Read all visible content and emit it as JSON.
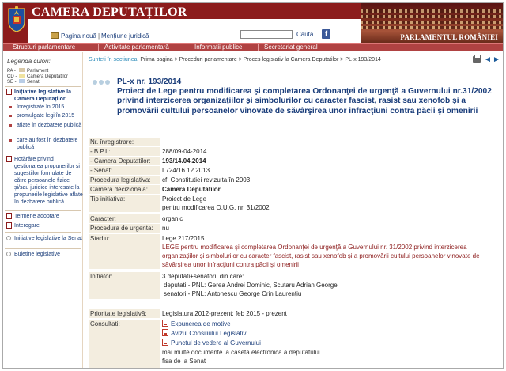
{
  "header": {
    "site_title": "CAMERA DEPUTAȚILOR",
    "top_links": [
      "Pagina nouă",
      "Mențiune juridică"
    ],
    "search_placeholder": "",
    "search_label": "Caută",
    "facebook_glyph": "f",
    "parliament_label": "PARLAMENTUL ROMÂNIEI"
  },
  "nav": {
    "items": [
      "Structuri parlamentare",
      "Activitate parlamentară",
      "Informații publice",
      "Secretariat general"
    ]
  },
  "sidebar": {
    "legend_title": "Legendă culori:",
    "legend": [
      {
        "code": "PA -",
        "label": "Parlament",
        "color": "#d9c9a8"
      },
      {
        "code": "CD -",
        "label": "Camera Deputatilor",
        "color": "#f0e3a0"
      },
      {
        "code": "SE -",
        "label": "Senat",
        "color": "#b9cde6"
      }
    ],
    "items": [
      {
        "label": "Inițiative legislative la Camera Deputaților"
      },
      {
        "label": "înregistrate în 2015"
      },
      {
        "label": "promulgate legi în 2015"
      },
      {
        "label": "aflate în dezbatere publică"
      },
      {
        "label": "care au fost în dezbatere publică"
      },
      {
        "label": "Hotărâre privind gestionarea propunerilor și sugestiilor formulate de către persoanele fizice și/sau juridice interesate la propunerile legislative aflate în dezbatere publică"
      },
      {
        "label": "Termene adoptare"
      },
      {
        "label": "Interogare"
      },
      {
        "label": "Inițiative legislative la Senat"
      },
      {
        "label": "Buletine legislative"
      }
    ]
  },
  "main": {
    "breadcrumb_lead": "Sunteți în secțiunea:",
    "breadcrumb": "Prima pagina > Proceduri parlamentare > Proces legislativ la Camera Deputatilor > PL-x 193/2014",
    "nav_prev": "◄",
    "nav_next": "►",
    "doc_id": "PL-x nr. 193/2014",
    "doc_title": "Proiect de Lege pentru modificarea şi completarea Ordonanţei de urgenţă a Guvernului nr.31/2002 privind interzicerea organizaţiilor şi simbolurilor cu caracter fascist, rasist sau xenofob şi a promovării cultului persoanelor vinovate de săvârşirea unor infracţiuni contra păcii şi omenirii",
    "details": {
      "nr_label": "Nr. înregistrare:",
      "bpi_label": "- B.P.I.:",
      "bpi_value": "288/09-04-2014",
      "cd_label": "- Camera Deputatilor:",
      "cd_value": "193/14.04.2014",
      "senat_label": "- Senat:",
      "senat_value": "L724/16.12.2013",
      "proc_label": "Procedura legislativa:",
      "proc_value": "cf. Constitutiei revizuita în 2003",
      "camera_label": "Camera decizionala:",
      "camera_value": "Camera Deputatilor",
      "tip_label": "Tip initiativa:",
      "tip_value_1": "Proiect de Lege",
      "tip_value_2": "pentru modificarea O.U.G. nr. 31/2002",
      "caracter_label": "Caracter:",
      "caracter_value": "organic",
      "urgenta_label": "Procedura de urgenta:",
      "urgenta_value": "nu",
      "stadiu_label": "Stadiu:",
      "stadiu_value_1": "Lege 217/2015",
      "stadiu_value_2": "LEGE pentru modificarea şi completarea Ordonanţei de urgenţă a Guvernului nr. 31/2002 privind interzicerea organizaţiilor şi simbolurilor cu caracter fascist, rasist sau xenofob şi a promovării cultului persoanelor vinovate de săvârşirea unor infracţiuni contra păcii şi omenirii",
      "initiator_label": "Initiator:",
      "initiator_value_1": "3 deputati+senatori, din care:",
      "initiator_value_2": "deputati - PNL: Gerea Andrei Dominic, Scutaru Adrian George",
      "initiator_value_3": "senatori - PNL: Antonescu George Crin Laurenţiu",
      "prioritate_label": "Prioritate legislativă:",
      "prioritate_value": "Legislatura 2012-prezent: feb 2015 - prezent",
      "consultati_label": "Consultati:",
      "consultati_links": [
        "Expunerea de motive",
        "Avizul Consiliului Legislativ",
        "Punctul de vedere al Guvernului"
      ],
      "consultati_more": "mai multe documente la caseta electronica a deputatului",
      "consultati_more_2": "fisa de la Senat"
    }
  }
}
